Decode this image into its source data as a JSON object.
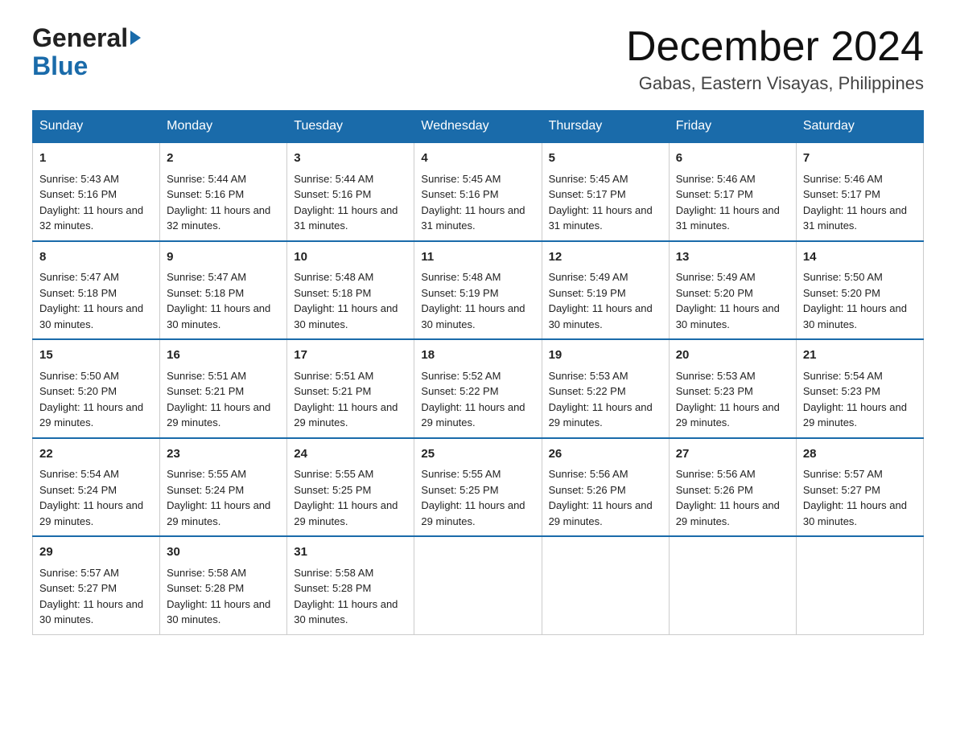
{
  "header": {
    "logo_general": "General",
    "logo_blue": "Blue",
    "month_title": "December 2024",
    "location": "Gabas, Eastern Visayas, Philippines"
  },
  "calendar": {
    "days_of_week": [
      "Sunday",
      "Monday",
      "Tuesday",
      "Wednesday",
      "Thursday",
      "Friday",
      "Saturday"
    ],
    "weeks": [
      [
        {
          "day": "1",
          "sunrise": "5:43 AM",
          "sunset": "5:16 PM",
          "daylight": "11 hours and 32 minutes."
        },
        {
          "day": "2",
          "sunrise": "5:44 AM",
          "sunset": "5:16 PM",
          "daylight": "11 hours and 32 minutes."
        },
        {
          "day": "3",
          "sunrise": "5:44 AM",
          "sunset": "5:16 PM",
          "daylight": "11 hours and 31 minutes."
        },
        {
          "day": "4",
          "sunrise": "5:45 AM",
          "sunset": "5:16 PM",
          "daylight": "11 hours and 31 minutes."
        },
        {
          "day": "5",
          "sunrise": "5:45 AM",
          "sunset": "5:17 PM",
          "daylight": "11 hours and 31 minutes."
        },
        {
          "day": "6",
          "sunrise": "5:46 AM",
          "sunset": "5:17 PM",
          "daylight": "11 hours and 31 minutes."
        },
        {
          "day": "7",
          "sunrise": "5:46 AM",
          "sunset": "5:17 PM",
          "daylight": "11 hours and 31 minutes."
        }
      ],
      [
        {
          "day": "8",
          "sunrise": "5:47 AM",
          "sunset": "5:18 PM",
          "daylight": "11 hours and 30 minutes."
        },
        {
          "day": "9",
          "sunrise": "5:47 AM",
          "sunset": "5:18 PM",
          "daylight": "11 hours and 30 minutes."
        },
        {
          "day": "10",
          "sunrise": "5:48 AM",
          "sunset": "5:18 PM",
          "daylight": "11 hours and 30 minutes."
        },
        {
          "day": "11",
          "sunrise": "5:48 AM",
          "sunset": "5:19 PM",
          "daylight": "11 hours and 30 minutes."
        },
        {
          "day": "12",
          "sunrise": "5:49 AM",
          "sunset": "5:19 PM",
          "daylight": "11 hours and 30 minutes."
        },
        {
          "day": "13",
          "sunrise": "5:49 AM",
          "sunset": "5:20 PM",
          "daylight": "11 hours and 30 minutes."
        },
        {
          "day": "14",
          "sunrise": "5:50 AM",
          "sunset": "5:20 PM",
          "daylight": "11 hours and 30 minutes."
        }
      ],
      [
        {
          "day": "15",
          "sunrise": "5:50 AM",
          "sunset": "5:20 PM",
          "daylight": "11 hours and 29 minutes."
        },
        {
          "day": "16",
          "sunrise": "5:51 AM",
          "sunset": "5:21 PM",
          "daylight": "11 hours and 29 minutes."
        },
        {
          "day": "17",
          "sunrise": "5:51 AM",
          "sunset": "5:21 PM",
          "daylight": "11 hours and 29 minutes."
        },
        {
          "day": "18",
          "sunrise": "5:52 AM",
          "sunset": "5:22 PM",
          "daylight": "11 hours and 29 minutes."
        },
        {
          "day": "19",
          "sunrise": "5:53 AM",
          "sunset": "5:22 PM",
          "daylight": "11 hours and 29 minutes."
        },
        {
          "day": "20",
          "sunrise": "5:53 AM",
          "sunset": "5:23 PM",
          "daylight": "11 hours and 29 minutes."
        },
        {
          "day": "21",
          "sunrise": "5:54 AM",
          "sunset": "5:23 PM",
          "daylight": "11 hours and 29 minutes."
        }
      ],
      [
        {
          "day": "22",
          "sunrise": "5:54 AM",
          "sunset": "5:24 PM",
          "daylight": "11 hours and 29 minutes."
        },
        {
          "day": "23",
          "sunrise": "5:55 AM",
          "sunset": "5:24 PM",
          "daylight": "11 hours and 29 minutes."
        },
        {
          "day": "24",
          "sunrise": "5:55 AM",
          "sunset": "5:25 PM",
          "daylight": "11 hours and 29 minutes."
        },
        {
          "day": "25",
          "sunrise": "5:55 AM",
          "sunset": "5:25 PM",
          "daylight": "11 hours and 29 minutes."
        },
        {
          "day": "26",
          "sunrise": "5:56 AM",
          "sunset": "5:26 PM",
          "daylight": "11 hours and 29 minutes."
        },
        {
          "day": "27",
          "sunrise": "5:56 AM",
          "sunset": "5:26 PM",
          "daylight": "11 hours and 29 minutes."
        },
        {
          "day": "28",
          "sunrise": "5:57 AM",
          "sunset": "5:27 PM",
          "daylight": "11 hours and 30 minutes."
        }
      ],
      [
        {
          "day": "29",
          "sunrise": "5:57 AM",
          "sunset": "5:27 PM",
          "daylight": "11 hours and 30 minutes."
        },
        {
          "day": "30",
          "sunrise": "5:58 AM",
          "sunset": "5:28 PM",
          "daylight": "11 hours and 30 minutes."
        },
        {
          "day": "31",
          "sunrise": "5:58 AM",
          "sunset": "5:28 PM",
          "daylight": "11 hours and 30 minutes."
        },
        null,
        null,
        null,
        null
      ]
    ]
  }
}
